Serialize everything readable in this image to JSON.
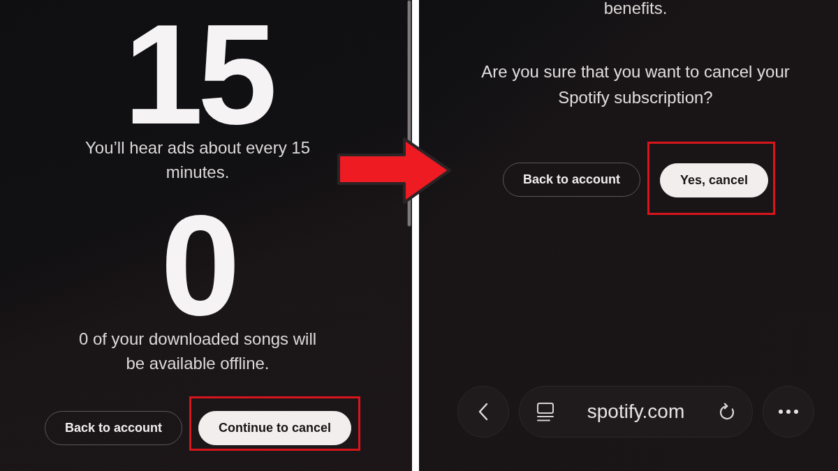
{
  "panels": [
    {
      "kind": "stats",
      "stats": [
        {
          "value": "15",
          "caption": "You’ll hear ads about every 15 minutes."
        },
        {
          "value": "0",
          "caption": "0 of your downloaded songs will be available offline."
        }
      ],
      "buttons": [
        {
          "label": "Back to account",
          "kind": "secondary",
          "highlighted": false
        },
        {
          "label": "Continue to cancel",
          "kind": "primary",
          "highlighted": true
        }
      ]
    },
    {
      "kind": "confirm",
      "lead_text": "benefits.",
      "question": "Are you sure that you want to cancel your Spotify subscription?",
      "buttons": [
        {
          "label": "Back to account",
          "kind": "secondary",
          "highlighted": false
        },
        {
          "label": "Yes, cancel",
          "kind": "primary",
          "highlighted": true
        }
      ],
      "browser_bar": {
        "url": "spotify.com"
      }
    }
  ]
}
